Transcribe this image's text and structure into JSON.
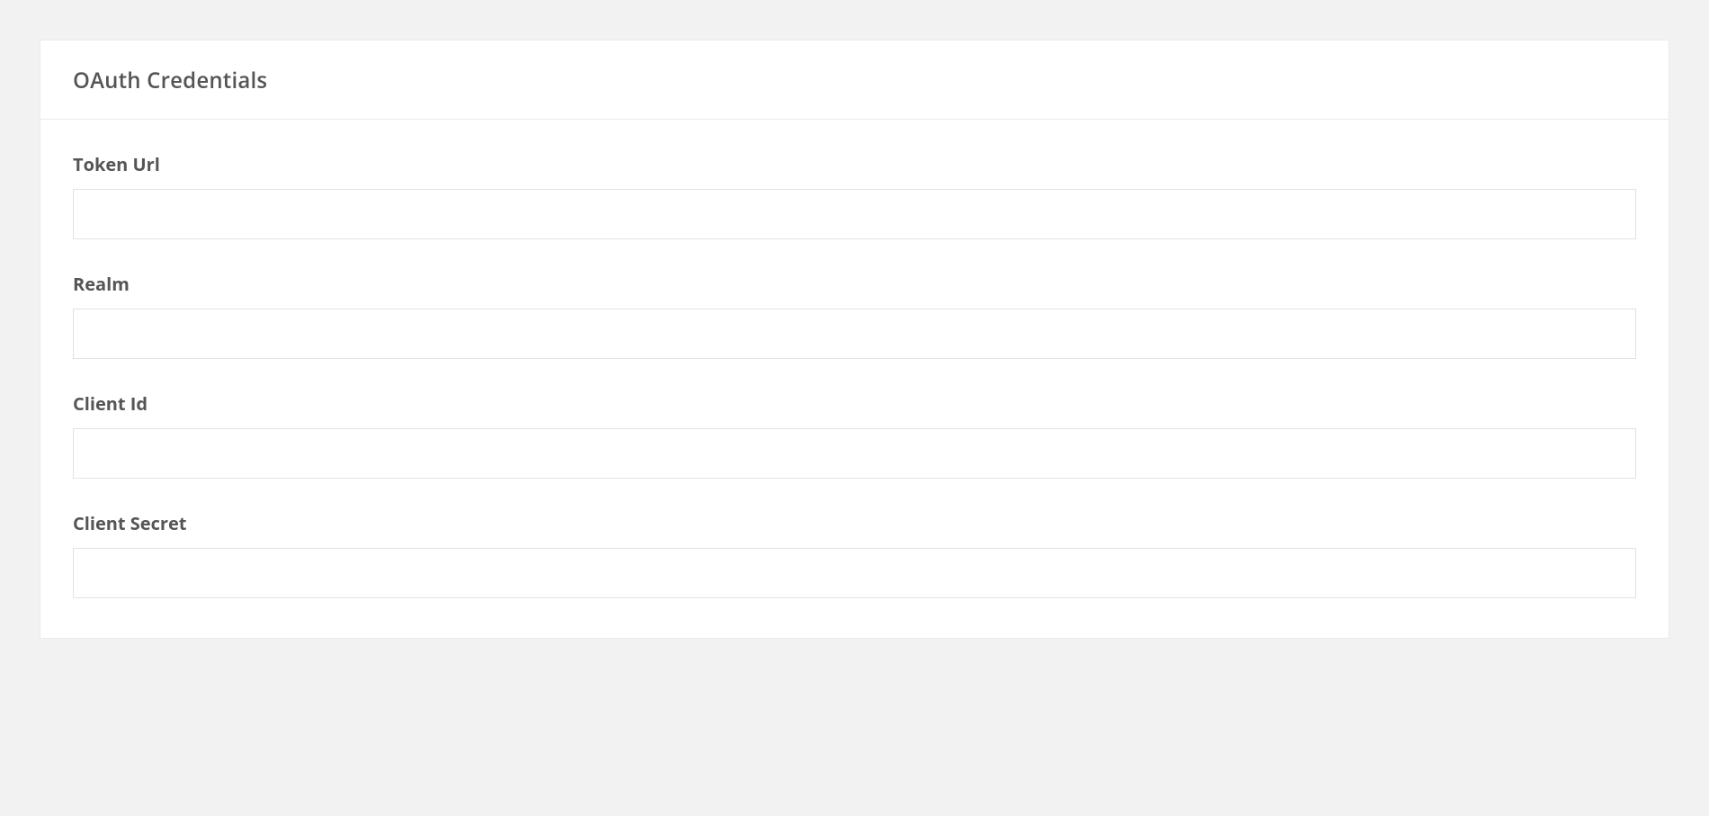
{
  "card": {
    "title": "OAuth Credentials"
  },
  "form": {
    "fields": [
      {
        "label": "Token Url",
        "value": ""
      },
      {
        "label": "Realm",
        "value": ""
      },
      {
        "label": "Client Id",
        "value": ""
      },
      {
        "label": "Client Secret",
        "value": ""
      }
    ]
  }
}
